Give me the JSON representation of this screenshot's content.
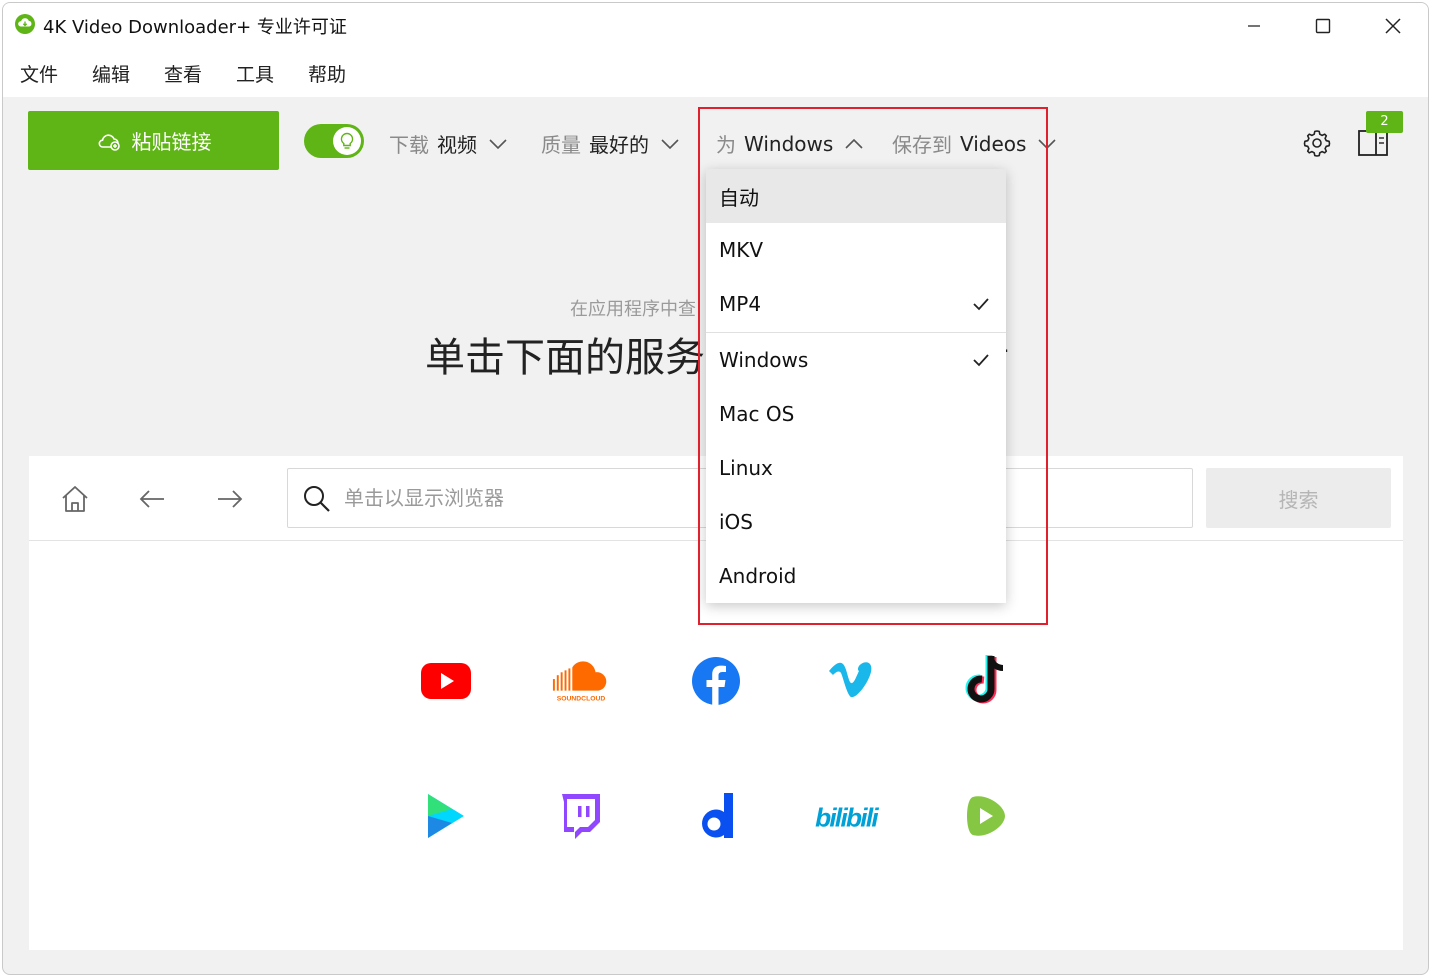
{
  "window": {
    "title": "4K Video Downloader+ 专业许可证"
  },
  "menu": [
    "文件",
    "编辑",
    "查看",
    "工具",
    "帮助"
  ],
  "toolbar": {
    "paste_label": "粘贴链接",
    "download_label": "下载",
    "download_value": "视频",
    "quality_label": "质量",
    "quality_value": "最好的",
    "for_label": "为",
    "for_value": "Windows",
    "save_label": "保存到",
    "save_value": "Videos",
    "queue_count": "2",
    "smart_mode": true
  },
  "hint": {
    "small": "在应用程序中查",
    "big": "单击下面的服务",
    "trailing": "·"
  },
  "browser": {
    "search_placeholder": "单击以显示浏览器",
    "search_button": "搜索",
    "services_row1": [
      "youtube-icon",
      "soundcloud-icon",
      "facebook-icon",
      "vimeo-icon",
      "tiktok-icon"
    ],
    "services_row2": [
      "google-play-icon",
      "twitch-icon",
      "dailymotion-icon",
      "bilibili-icon",
      "rumble-icon"
    ],
    "soundcloud_text": "SOUNDCLOUD",
    "bilibili_text": "bilibili"
  },
  "dropdown": {
    "items": [
      {
        "label": "自动",
        "checked": false,
        "highlighted": true
      },
      {
        "label": "MKV",
        "checked": false
      },
      {
        "label": "MP4",
        "checked": true
      },
      {
        "label": "Windows",
        "checked": true
      },
      {
        "label": "Mac OS",
        "checked": false
      },
      {
        "label": "Linux",
        "checked": false
      },
      {
        "label": "iOS",
        "checked": false
      },
      {
        "label": "Android",
        "checked": false
      }
    ]
  },
  "colors": {
    "accent_green": "#5fb416",
    "highlight_red": "#e0202f"
  }
}
